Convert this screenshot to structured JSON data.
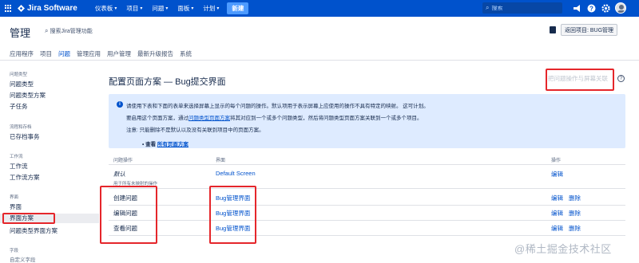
{
  "topbar": {
    "logo": "Jira Software",
    "nav": [
      {
        "label": "仪表板"
      },
      {
        "label": "项目"
      },
      {
        "label": "问题"
      },
      {
        "label": "面板"
      },
      {
        "label": "计划"
      }
    ],
    "create_label": "新建",
    "search_placeholder": "搜索",
    "icons": [
      "megaphone-icon",
      "help-icon",
      "gear-icon"
    ],
    "brand_color": "#0052cc"
  },
  "admin": {
    "title": "管理",
    "search_label": "搜索Jira管理功能",
    "back_label": "返回项目: BUG管理",
    "tabs": [
      "应用程序",
      "项目",
      "问题",
      "管理应用",
      "用户管理",
      "最新升级报告",
      "系统"
    ],
    "active_tab": "问题"
  },
  "sidebar": {
    "sections": [
      {
        "heading": "问题类型",
        "items": [
          "问题类型",
          "问题类型方案",
          "子任务"
        ]
      },
      {
        "heading": "流程和存档",
        "items": [
          "已存档事务"
        ]
      },
      {
        "heading": "工作流",
        "items": [
          "工作流",
          "工作流方案"
        ]
      },
      {
        "heading": "界面",
        "items": [
          "界面",
          "界面方案",
          "问题类型界面方案"
        ]
      },
      {
        "heading": "字段",
        "items": [
          "自定义字段"
        ]
      }
    ],
    "active_item": "界面方案"
  },
  "main": {
    "title": "配置页面方案 — Bug提交界面",
    "assoc_link": "把问题操作与屏幕关联",
    "info": {
      "line1": "请使用下表和下面的表单来选择屏幕上显示的每个问题的操作。默认项用于表示屏幕上应使用的操作不具有特定的映射。 这可计划。",
      "line2_pre": "要启用这个页面方案，通过",
      "line2_link": "问题类型页面方案",
      "line2_post": "将其对应到一个或多个问题类型，然后将问题类型页面方案关联到一个或多个项目。",
      "line3": "注意: 只能删除不是默认以及没有关联到项目中的页面方案。",
      "bullet_pre": "• 查看 ",
      "bullet_link": "所有页面方案"
    },
    "table": {
      "headers": {
        "op": "问题操作",
        "screen": "界面",
        "actions": "操作"
      },
      "default_row": {
        "op": "默认",
        "screen": "Default Screen",
        "edit": "编辑",
        "note": "用于所有未映射的操作"
      },
      "rows": [
        {
          "op": "创建问题",
          "screen": "Bug管理界面",
          "edit": "编辑",
          "delete": "删除"
        },
        {
          "op": "编辑问题",
          "screen": "Bug管理界面",
          "edit": "编辑",
          "delete": "删除"
        },
        {
          "op": "查看问题",
          "screen": "Bug管理界面",
          "edit": "编辑",
          "delete": "删除"
        }
      ]
    }
  },
  "watermark": "@稀土掘金技术社区",
  "annotation_color": "#e5262b"
}
